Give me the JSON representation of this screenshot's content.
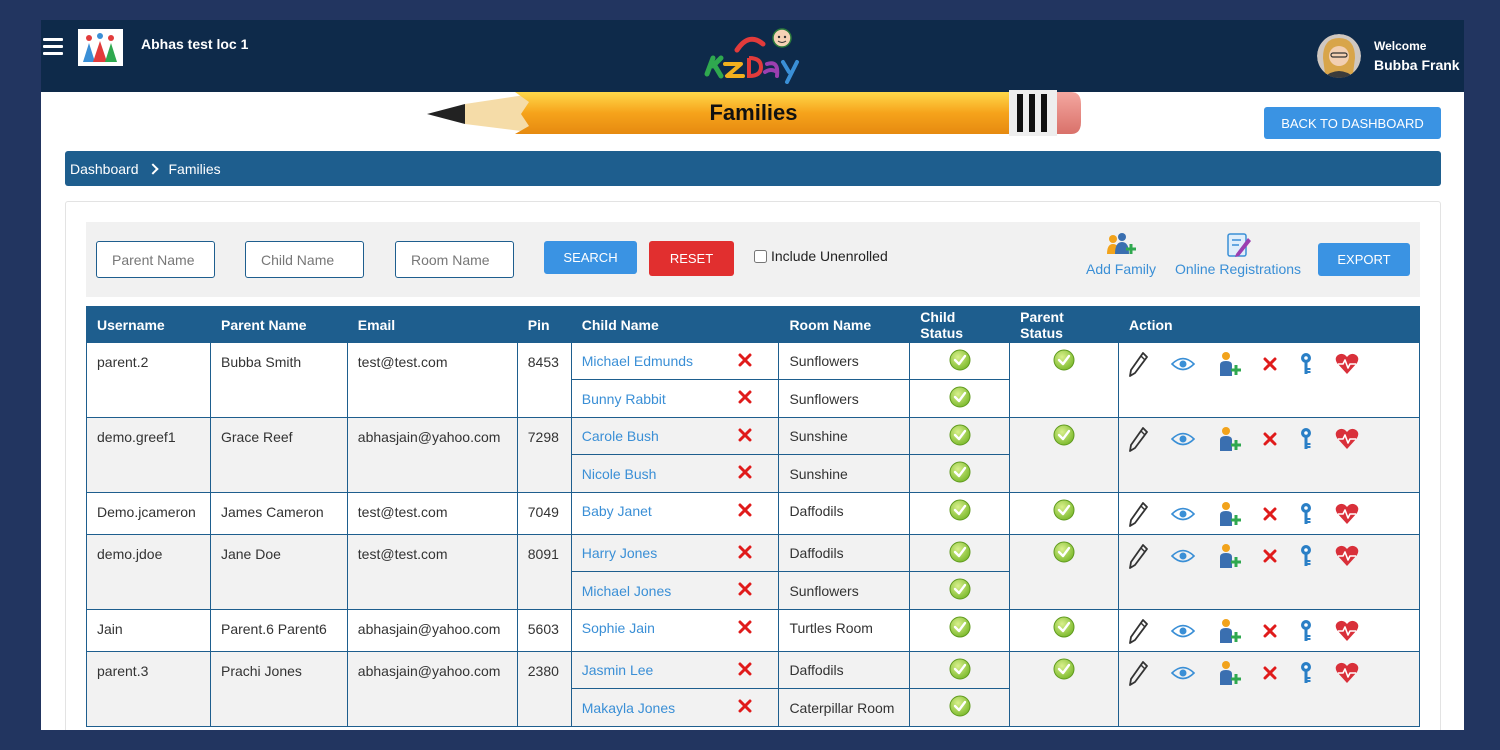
{
  "header": {
    "location_name": "Abhas test loc 1",
    "welcome": "Welcome",
    "user_name": "Bubba Frank"
  },
  "page": {
    "title": "Families",
    "back_button": "BACK TO DASHBOARD"
  },
  "breadcrumb": [
    "Dashboard",
    "Families"
  ],
  "filters": {
    "parent_placeholder": "Parent Name",
    "child_placeholder": "Child Name",
    "room_placeholder": "Room Name",
    "search_label": "SEARCH",
    "reset_label": "RESET",
    "include_unenrolled": "Include Unenrolled",
    "add_family": "Add Family",
    "online_registrations": "Online Registrations",
    "export_label": "EXPORT"
  },
  "table": {
    "columns": [
      "Username",
      "Parent Name",
      "Email",
      "Pin",
      "Child Name",
      "Room Name",
      "Child Status",
      "Parent Status",
      "Action"
    ],
    "rows": [
      {
        "username": "parent.2",
        "parent": "Bubba Smith",
        "email": "test@test.com",
        "pin": "8453",
        "children": [
          {
            "name": "Michael Edmunds",
            "room": "Sunflowers"
          },
          {
            "name": "Bunny Rabbit",
            "room": "Sunflowers"
          }
        ]
      },
      {
        "username": "demo.greef1",
        "parent": "Grace Reef",
        "email": "abhasjain@yahoo.com",
        "pin": "7298",
        "children": [
          {
            "name": "Carole Bush",
            "room": "Sunshine"
          },
          {
            "name": "Nicole Bush",
            "room": "Sunshine"
          }
        ]
      },
      {
        "username": "Demo.jcameron",
        "parent": "James Cameron",
        "email": "test@test.com",
        "pin": "7049",
        "children": [
          {
            "name": "Baby Janet",
            "room": "Daffodils"
          }
        ]
      },
      {
        "username": "demo.jdoe",
        "parent": "Jane Doe",
        "email": "test@test.com",
        "pin": "8091",
        "children": [
          {
            "name": "Harry Jones",
            "room": "Daffodils"
          },
          {
            "name": "Michael Jones",
            "room": "Sunflowers"
          }
        ]
      },
      {
        "username": "Jain",
        "parent": "Parent.6 Parent6",
        "email": "abhasjain@yahoo.com",
        "pin": "5603",
        "children": [
          {
            "name": "Sophie Jain",
            "room": "Turtles Room"
          }
        ]
      },
      {
        "username": "parent.3",
        "parent": "Prachi Jones",
        "email": "abhasjain@yahoo.com",
        "pin": "2380",
        "children": [
          {
            "name": "Jasmin Lee",
            "room": "Daffodils"
          },
          {
            "name": "Makayla Jones",
            "room": "Caterpillar Room"
          }
        ]
      }
    ]
  },
  "icons": {
    "child_status": "check-circle-icon",
    "parent_status": "check-circle-icon",
    "child_remove": "red-x-icon",
    "actions": [
      "pencil-icon",
      "eye-icon",
      "add-user-icon",
      "red-x-icon",
      "key-icon",
      "heart-pulse-icon"
    ]
  },
  "colors": {
    "header_bg": "#0e2a4a",
    "accent_blue": "#1e5e8e",
    "button_blue": "#3a93e3",
    "reset_red": "#e12f2f",
    "link_blue": "#3a8fd6"
  }
}
